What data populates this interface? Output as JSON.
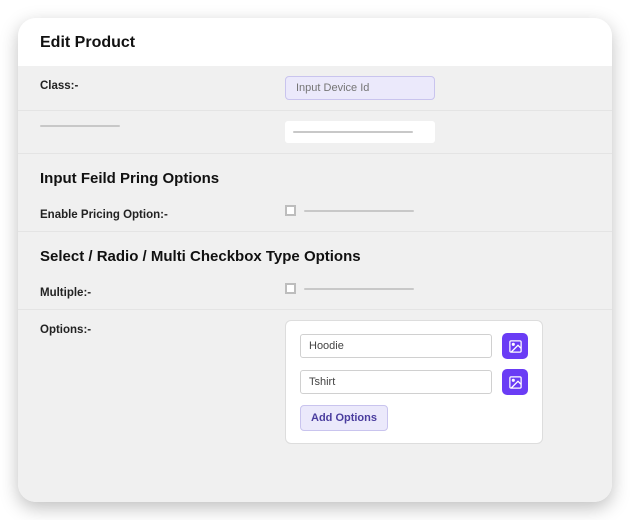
{
  "header": {
    "title": "Edit Product"
  },
  "rows": {
    "class": {
      "label": "Class:-",
      "placeholder": "Input Device Id"
    }
  },
  "sections": {
    "pricing": {
      "title": "Input Feild Pring Options",
      "enable_label": "Enable Pricing Option:-"
    },
    "select": {
      "title": "Select / Radio / Multi Checkbox Type Options",
      "multiple_label": "Multiple:-",
      "options_label": "Options:-",
      "options": [
        {
          "value": "Hoodie"
        },
        {
          "value": "Tshirt"
        }
      ],
      "add_button": "Add Options"
    }
  }
}
